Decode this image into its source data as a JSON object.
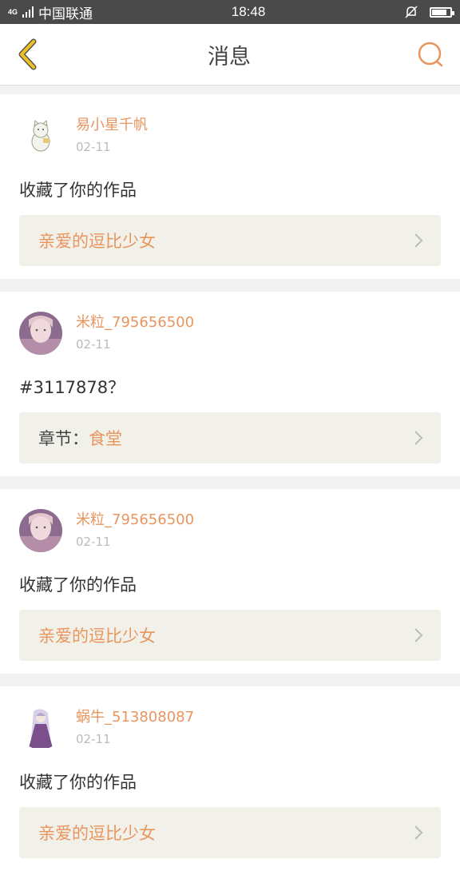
{
  "status_bar": {
    "network_type": "4G",
    "carrier": "中国联通",
    "time": "18:48",
    "battery_level": 0.8
  },
  "header": {
    "title": "消息",
    "back_icon": "chevron-left-icon",
    "search_icon": "search-icon"
  },
  "colors": {
    "accent": "#e8955e",
    "back_icon": "#f0c020",
    "link_box_bg": "#f1f1ea"
  },
  "messages": [
    {
      "username": "易小星千帆",
      "time": "02-11",
      "content": "收藏了你的作品",
      "link_prefix": "",
      "link_title": "亲爱的逗比少女"
    },
    {
      "username": "米粒_795656500",
      "time": "02-11",
      "content": "#3117878？",
      "link_prefix": "章节：",
      "link_title": "食堂"
    },
    {
      "username": "米粒_795656500",
      "time": "02-11",
      "content": "收藏了你的作品",
      "link_prefix": "",
      "link_title": "亲爱的逗比少女"
    },
    {
      "username": "蜗牛_513808087",
      "time": "02-11",
      "content": "收藏了你的作品",
      "link_prefix": "",
      "link_title": "亲爱的逗比少女"
    }
  ]
}
